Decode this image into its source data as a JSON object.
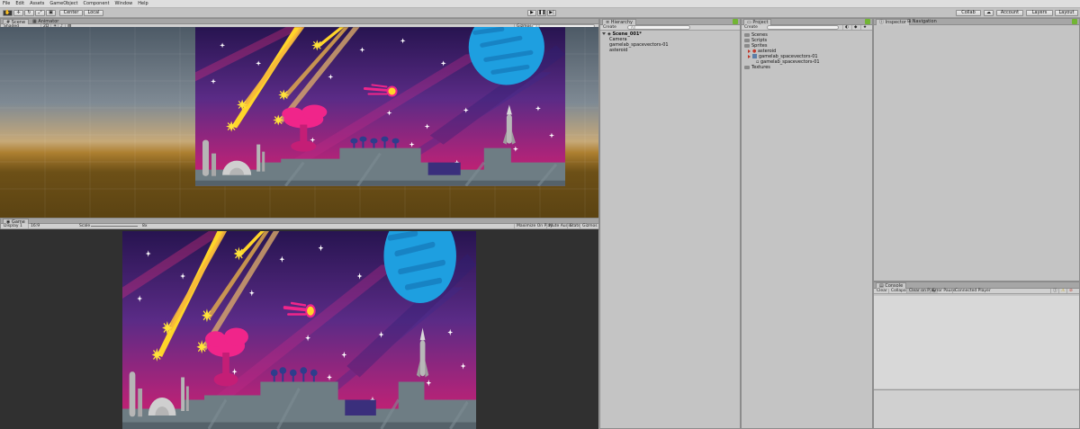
{
  "menu": [
    "File",
    "Edit",
    "Assets",
    "GameObject",
    "Component",
    "Window",
    "Help"
  ],
  "toolbar": {
    "pivot": "Center",
    "space": "Local",
    "collab": "Collab",
    "account": "Account",
    "layers": "Layers",
    "layout": "Layout"
  },
  "scene": {
    "tabs": [
      "Scene",
      "Animator"
    ],
    "shading": "Shaded",
    "mode_2d": "2D",
    "gizmos": "Gizmos",
    "search_placeholder": "All"
  },
  "game": {
    "tab": "Game",
    "display": "Display 1",
    "aspect": "16:9",
    "scale_label": "Scale",
    "scale_value": "8x",
    "buttons": [
      "Maximize On Play",
      "Mute Audio",
      "Stats",
      "Gizmos"
    ]
  },
  "hierarchy": {
    "tab": "Hierarchy",
    "create": "Create",
    "search_placeholder": "All",
    "scene_name": "Scene_001*",
    "items": [
      "Camera",
      "gamelab_spacevectors-01",
      "asteroid"
    ]
  },
  "project": {
    "tab": "Project",
    "create": "Create",
    "items": [
      "Scenes",
      "Scripts",
      "Sprites",
      "asteroid",
      "gamelab_spacevectors-01",
      "gamelab_spacevectors-01",
      "Textures"
    ]
  },
  "inspector": {
    "tabs": [
      "Inspector",
      "Navigation"
    ]
  },
  "console": {
    "tab": "Console",
    "buttons": [
      "Clear",
      "Collapse",
      "Clear on Play",
      "Error Pause",
      "Connected Player"
    ]
  },
  "colors": {
    "space_top": "#2b1556",
    "space_mid": "#6b2a8a",
    "space_bottom": "#d41f6f",
    "planet": "#1e9fe0",
    "ground": "#6e7d84",
    "star": "#ffe23a",
    "tree": "#f0258a",
    "accent_green": "#72b534"
  }
}
